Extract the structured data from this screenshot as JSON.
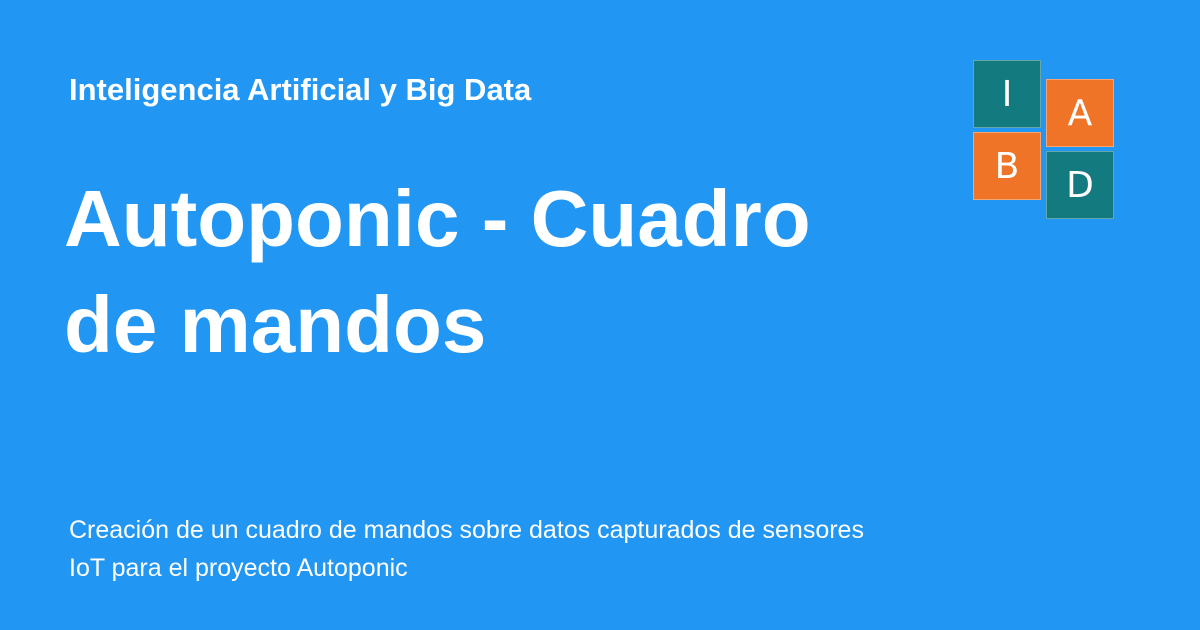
{
  "site": {
    "name": "Inteligencia Artificial y Big Data"
  },
  "page": {
    "title": "Autoponic - Cuadro de mandos",
    "description": "Creación de un cuadro de mandos sobre datos capturados de sensores IoT para el proyecto Autoponic"
  },
  "logo": {
    "letters": [
      "I",
      "A",
      "B",
      "D"
    ]
  },
  "colors": {
    "background": "#2196f3",
    "logo_teal": "#137a80",
    "logo_orange": "#f07427",
    "text": "#ffffff"
  }
}
